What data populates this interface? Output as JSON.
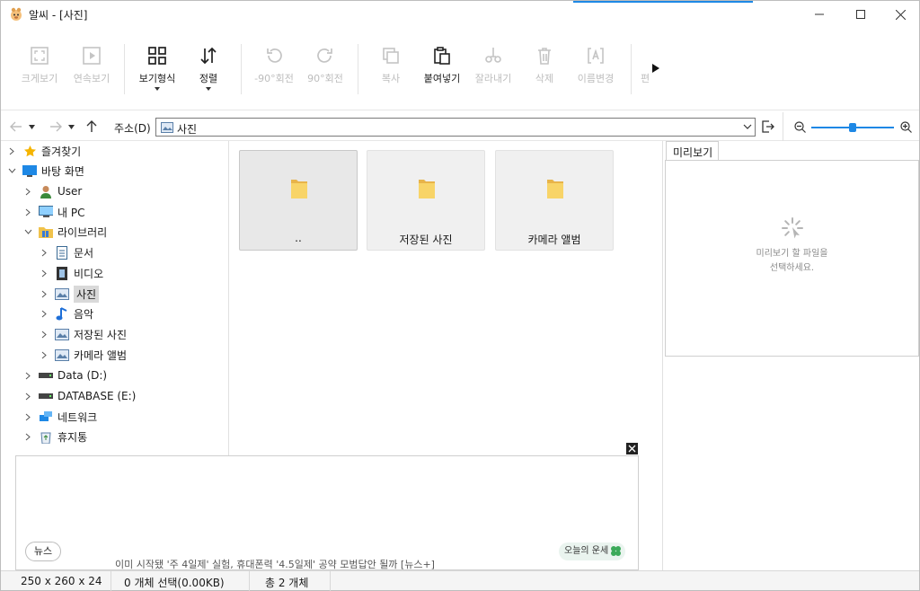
{
  "window": {
    "title": "알씨 - [사진]",
    "accent_color": "#1e88e5"
  },
  "toolbar": {
    "buttons": [
      {
        "label": "크게보기",
        "icon": "fullscreen-icon",
        "enabled": false
      },
      {
        "label": "연속보기",
        "icon": "play-icon",
        "enabled": false
      },
      {
        "label": "보기형식",
        "icon": "grid-icon",
        "enabled": true,
        "has_dropdown": true
      },
      {
        "label": "정렬",
        "icon": "sort-icon",
        "enabled": true,
        "has_dropdown": true
      },
      {
        "label": "-90°회전",
        "icon": "rotate-left-icon",
        "enabled": false
      },
      {
        "label": "90°회전",
        "icon": "rotate-right-icon",
        "enabled": false
      },
      {
        "label": "복사",
        "icon": "copy-icon",
        "enabled": false
      },
      {
        "label": "붙여넣기",
        "icon": "paste-icon",
        "enabled": true
      },
      {
        "label": "잘라내기",
        "icon": "cut-icon",
        "enabled": false
      },
      {
        "label": "삭제",
        "icon": "trash-icon",
        "enabled": false
      },
      {
        "label": "이름변경",
        "icon": "rename-icon",
        "enabled": false
      },
      {
        "label": "편",
        "icon": "edit-icon",
        "enabled": false
      }
    ]
  },
  "address": {
    "label": "주소(D)",
    "value": "사진"
  },
  "tree": [
    {
      "label": "즐겨찾기",
      "icon": "star-icon"
    },
    {
      "label": "바탕 화면",
      "icon": "desktop-icon"
    },
    {
      "label": "User",
      "icon": "user-icon"
    },
    {
      "label": "내 PC",
      "icon": "pc-icon"
    },
    {
      "label": "라이브러리",
      "icon": "library-icon"
    },
    {
      "label": "문서",
      "icon": "document-icon"
    },
    {
      "label": "비디오",
      "icon": "video-icon"
    },
    {
      "label": "사진",
      "icon": "picture-icon",
      "selected": true
    },
    {
      "label": "음악",
      "icon": "music-icon"
    },
    {
      "label": "저장된 사진",
      "icon": "picture-icon"
    },
    {
      "label": "카메라 앨범",
      "icon": "picture-icon"
    },
    {
      "label": "Data (D:)",
      "icon": "drive-icon"
    },
    {
      "label": "DATABASE (E:)",
      "icon": "drive-icon"
    },
    {
      "label": "네트워크",
      "icon": "network-icon"
    },
    {
      "label": "휴지통",
      "icon": "recycle-bin-icon"
    }
  ],
  "files": [
    {
      "name": "..",
      "selected": true
    },
    {
      "name": "저장된 사진"
    },
    {
      "name": "카메라 앨범"
    }
  ],
  "preview": {
    "tab": "미리보기",
    "line1": "미리보기 할 파일을",
    "line2": "선택하세요."
  },
  "ad": {
    "news_label": "뉴스",
    "news_text": "이미 시작됐 '주 4일제' 실험, 휴대폰력 '4.5일제' 공약 모범답안 될까 [뉴스+]",
    "fortune_label": "오늘의 운세"
  },
  "status": {
    "dimensions": "250 x 260 x 24",
    "selection": "0 개체 선택(0.00KB)",
    "total": "총 2 개체"
  }
}
